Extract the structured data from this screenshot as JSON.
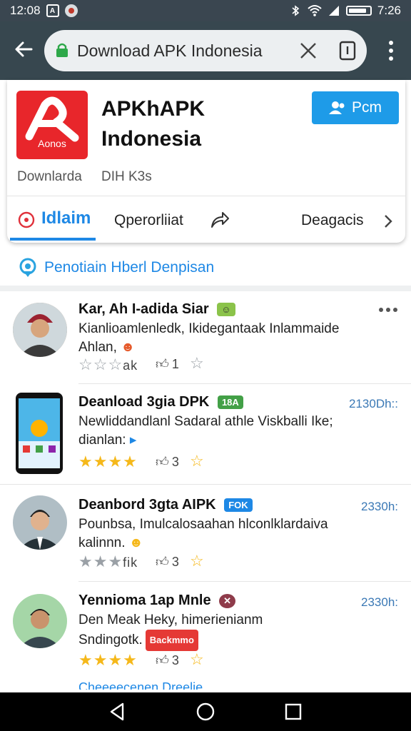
{
  "status_bar": {
    "time_left": "12:08",
    "time_right": "7:26",
    "battery_level": 0.85
  },
  "browser": {
    "url_text": "Download APK Indonesia",
    "icons": [
      "back-arrow-icon",
      "lock-icon",
      "close-icon",
      "tab-switcher-icon",
      "overflow-menu-icon"
    ]
  },
  "app": {
    "title_line1": "APKhAPK",
    "title_line2": "Indonesia",
    "logo_label": "Aonos",
    "primary_button": "Pcm",
    "meta_left": "Downlarda",
    "meta_right": "DIH K3s",
    "tabs": [
      {
        "label": "Idlaim",
        "active": true
      },
      {
        "label": "Qperorliiat",
        "active": false
      },
      {
        "label": "Deagacis",
        "active": false
      }
    ]
  },
  "section_link": "Penotiain Hberl Denpisan",
  "reviews": [
    {
      "name": "Kar, Ah I-adida Siar",
      "text_line1": "Kianlioamlenledk, Ikidegantaak Inlammaide",
      "text_line2": "Ahlan,",
      "rating_text": "ak",
      "rating": 3,
      "likes": "1",
      "time": ""
    },
    {
      "name": "Deanload 3gia DPK",
      "badge": "18A",
      "text_line1": "Newliddandlanl Sadaral athle Viskballi Ike;",
      "text_line2": "dianlan:",
      "rating": 4,
      "likes": "3",
      "time": "2130Dh::"
    },
    {
      "name": "Deanbord 3gta AIPK",
      "badge": "FOK",
      "text_line1": "Pounbsa, Imulcalosaahan hlconlklardaiva",
      "text_line2": "kalinnn.",
      "rating_text": "fik",
      "rating": 3,
      "likes": "3",
      "time": "2330h:"
    },
    {
      "name": "Yennioma 1ap Mnle",
      "text_line1": "Den Meak Heky, himerienianm",
      "text_line2": "Sndingotk.",
      "badge2": "Backmmo",
      "rating": 4,
      "likes": "3",
      "time": "2330h:"
    }
  ],
  "footer_partial": "Cheeeecenen Dreelie",
  "colors": {
    "accent": "#1e88e5",
    "toolbar": "#37474f",
    "status_bar": "#3a4650",
    "app_logo": "#e8262b",
    "button": "#1e9be8",
    "star": "#f5b81a"
  }
}
